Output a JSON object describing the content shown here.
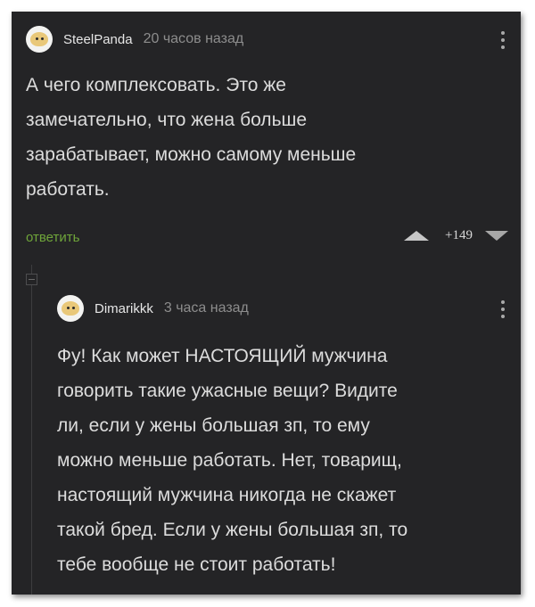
{
  "comment": {
    "username": "SteelPanda",
    "time": "20 часов назад",
    "lines": [
      "А чего комплексовать. Это же",
      "замечательно, что жена больше",
      "зарабатывает, можно самому меньше",
      "работать."
    ],
    "reply_label": "ответить",
    "rating": "+149"
  },
  "reply": {
    "username": "Dimarikkk",
    "time": "3 часа назад",
    "lines": [
      "Фу! Как может НАСТОЯЩИЙ мужчина",
      "говорить такие ужасные вещи? Видите",
      "ли, если у жены большая зп, то ему",
      "можно меньше работать. Нет, товарищ,",
      "настоящий мужчина никогда не скажет",
      "такой бред. Если у жены большая зп, то",
      "тебе вообще не стоит работать!"
    ]
  },
  "icons": {
    "avatar": "avatar-icon",
    "menu": "more-vertical-icon",
    "upvote": "arrow-up-icon",
    "downvote": "arrow-down-icon",
    "collapse": "collapse-thread-icon"
  },
  "colors": {
    "background": "#242426",
    "text": "#dcdcdc",
    "meta": "#8d8d8d",
    "reply_link": "#6fa53a"
  }
}
